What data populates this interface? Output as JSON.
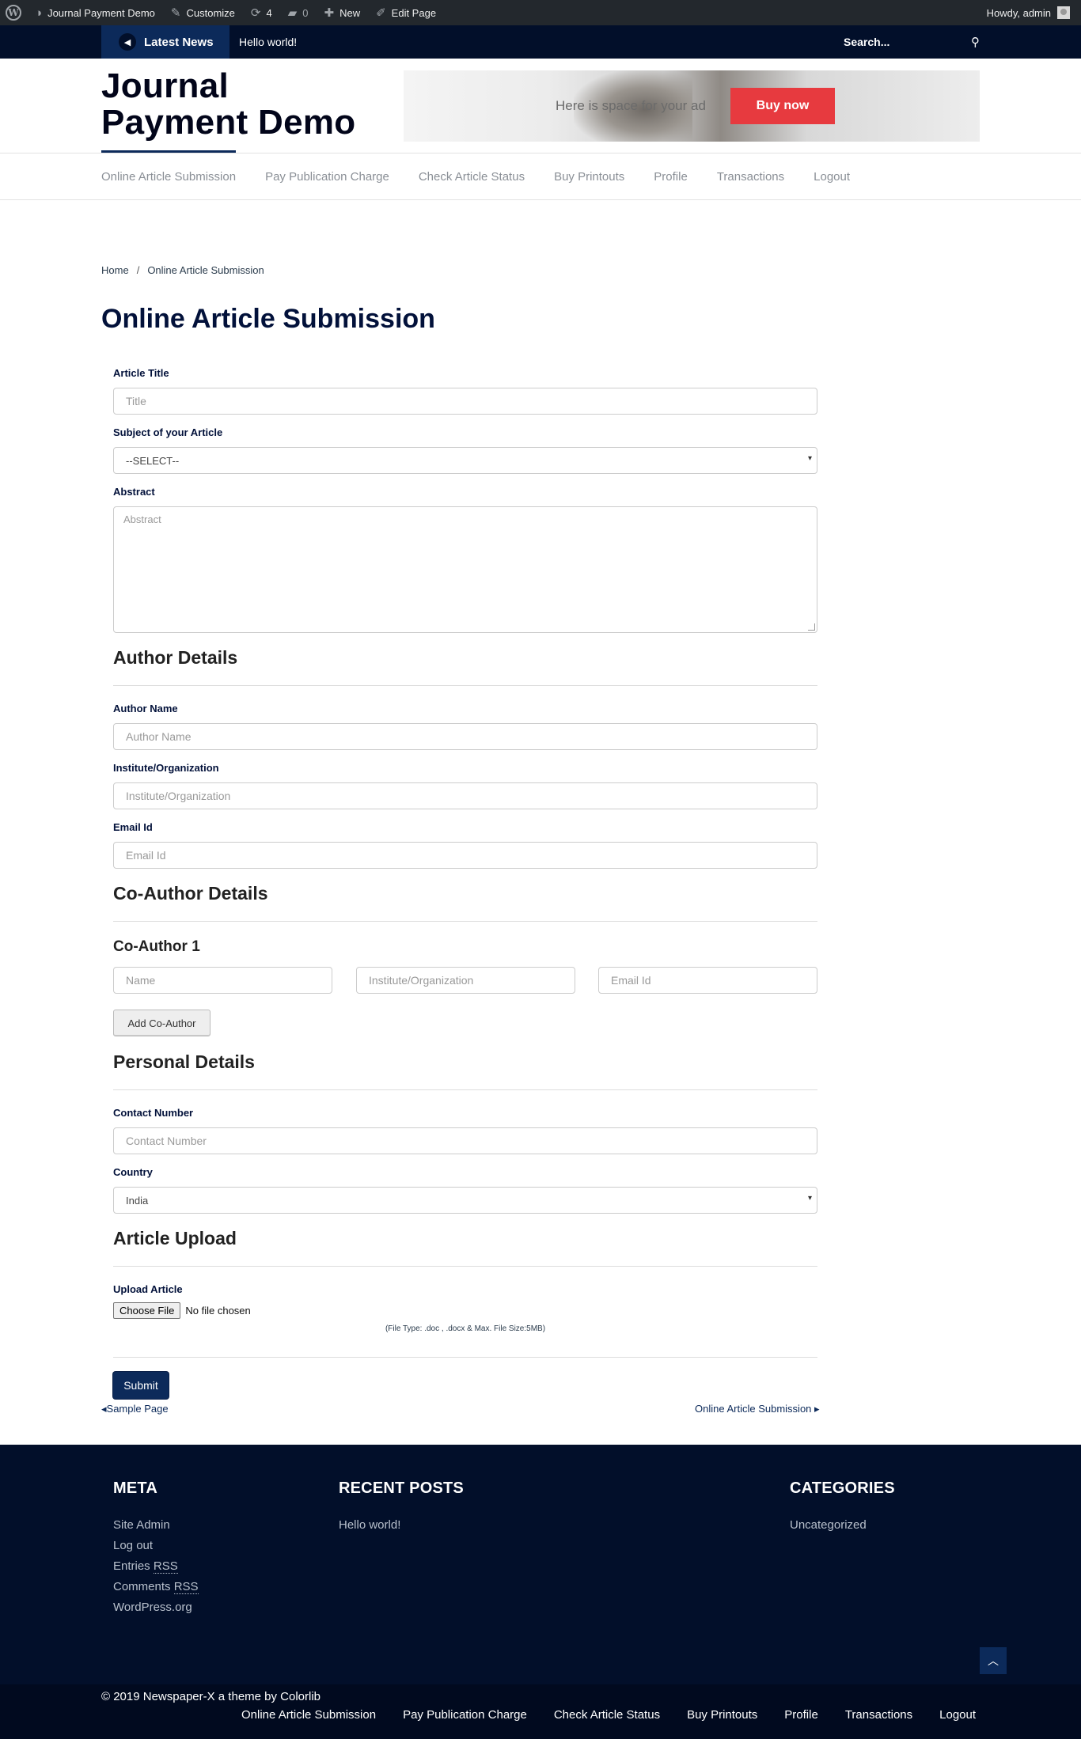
{
  "admin_bar": {
    "site_name": "Journal Payment Demo",
    "customize": "Customize",
    "updates_count": "4",
    "comments_count": "0",
    "new": "New",
    "edit_page": "Edit Page",
    "howdy": "Howdy, admin"
  },
  "top_bar": {
    "latest_news": "Latest News",
    "ticker": "Hello world!",
    "search_placeholder": "Search..."
  },
  "header": {
    "site_title": "Journal Payment Demo",
    "ad_text": "Here is space for your ad",
    "ad_button": "Buy now"
  },
  "nav": {
    "items": [
      "Online Article Submission",
      "Pay Publication Charge",
      "Check Article Status",
      "Buy Printouts",
      "Profile",
      "Transactions",
      "Logout"
    ]
  },
  "breadcrumb": {
    "home": "Home",
    "separator": "/",
    "current": "Online Article Submission"
  },
  "page_title": "Online Article Submission",
  "form": {
    "article_title_label": "Article Title",
    "article_title_placeholder": "Title",
    "subject_label": "Subject of your Article",
    "subject_value": "--SELECT--",
    "abstract_label": "Abstract",
    "abstract_placeholder": "Abstract",
    "author_section": "Author Details",
    "author_name_label": "Author Name",
    "author_name_placeholder": "Author Name",
    "institute_label": "Institute/Organization",
    "institute_placeholder": "Institute/Organization",
    "email_label": "Email Id",
    "email_placeholder": "Email Id",
    "coauthor_section": "Co-Author Details",
    "coauthor_1_title": "Co-Author 1",
    "coauthor_name_placeholder": "Name",
    "coauthor_institute_placeholder": "Institute/Organization",
    "coauthor_email_placeholder": "Email Id",
    "add_coauthor": "Add Co-Author",
    "personal_section": "Personal Details",
    "contact_label": "Contact Number",
    "contact_placeholder": "Contact Number",
    "country_label": "Country",
    "country_value": "India",
    "upload_section": "Article Upload",
    "upload_label": "Upload Article",
    "choose_file": "Choose File",
    "no_file": "No file chosen",
    "file_note": "(File Type: .doc , .docx & Max. File Size:5MB)",
    "submit": "Submit"
  },
  "post_nav": {
    "prev": "Sample Page",
    "next": "Online Article Submission"
  },
  "footer": {
    "meta_title": "META",
    "meta_links": [
      "Site Admin",
      "Log out"
    ],
    "entries": "Entries",
    "comments": "Comments",
    "rss": "RSS",
    "wordpress": "WordPress.org",
    "recent_title": "RECENT POSTS",
    "recent_posts": [
      "Hello world!"
    ],
    "categories_title": "CATEGORIES",
    "categories": [
      "Uncategorized"
    ],
    "copyright": "© 2019 Newspaper-X a theme by Colorlib",
    "nav": [
      "Online Article Submission",
      "Pay Publication Charge",
      "Check Article Status",
      "Buy Printouts",
      "Profile",
      "Transactions",
      "Logout"
    ]
  }
}
